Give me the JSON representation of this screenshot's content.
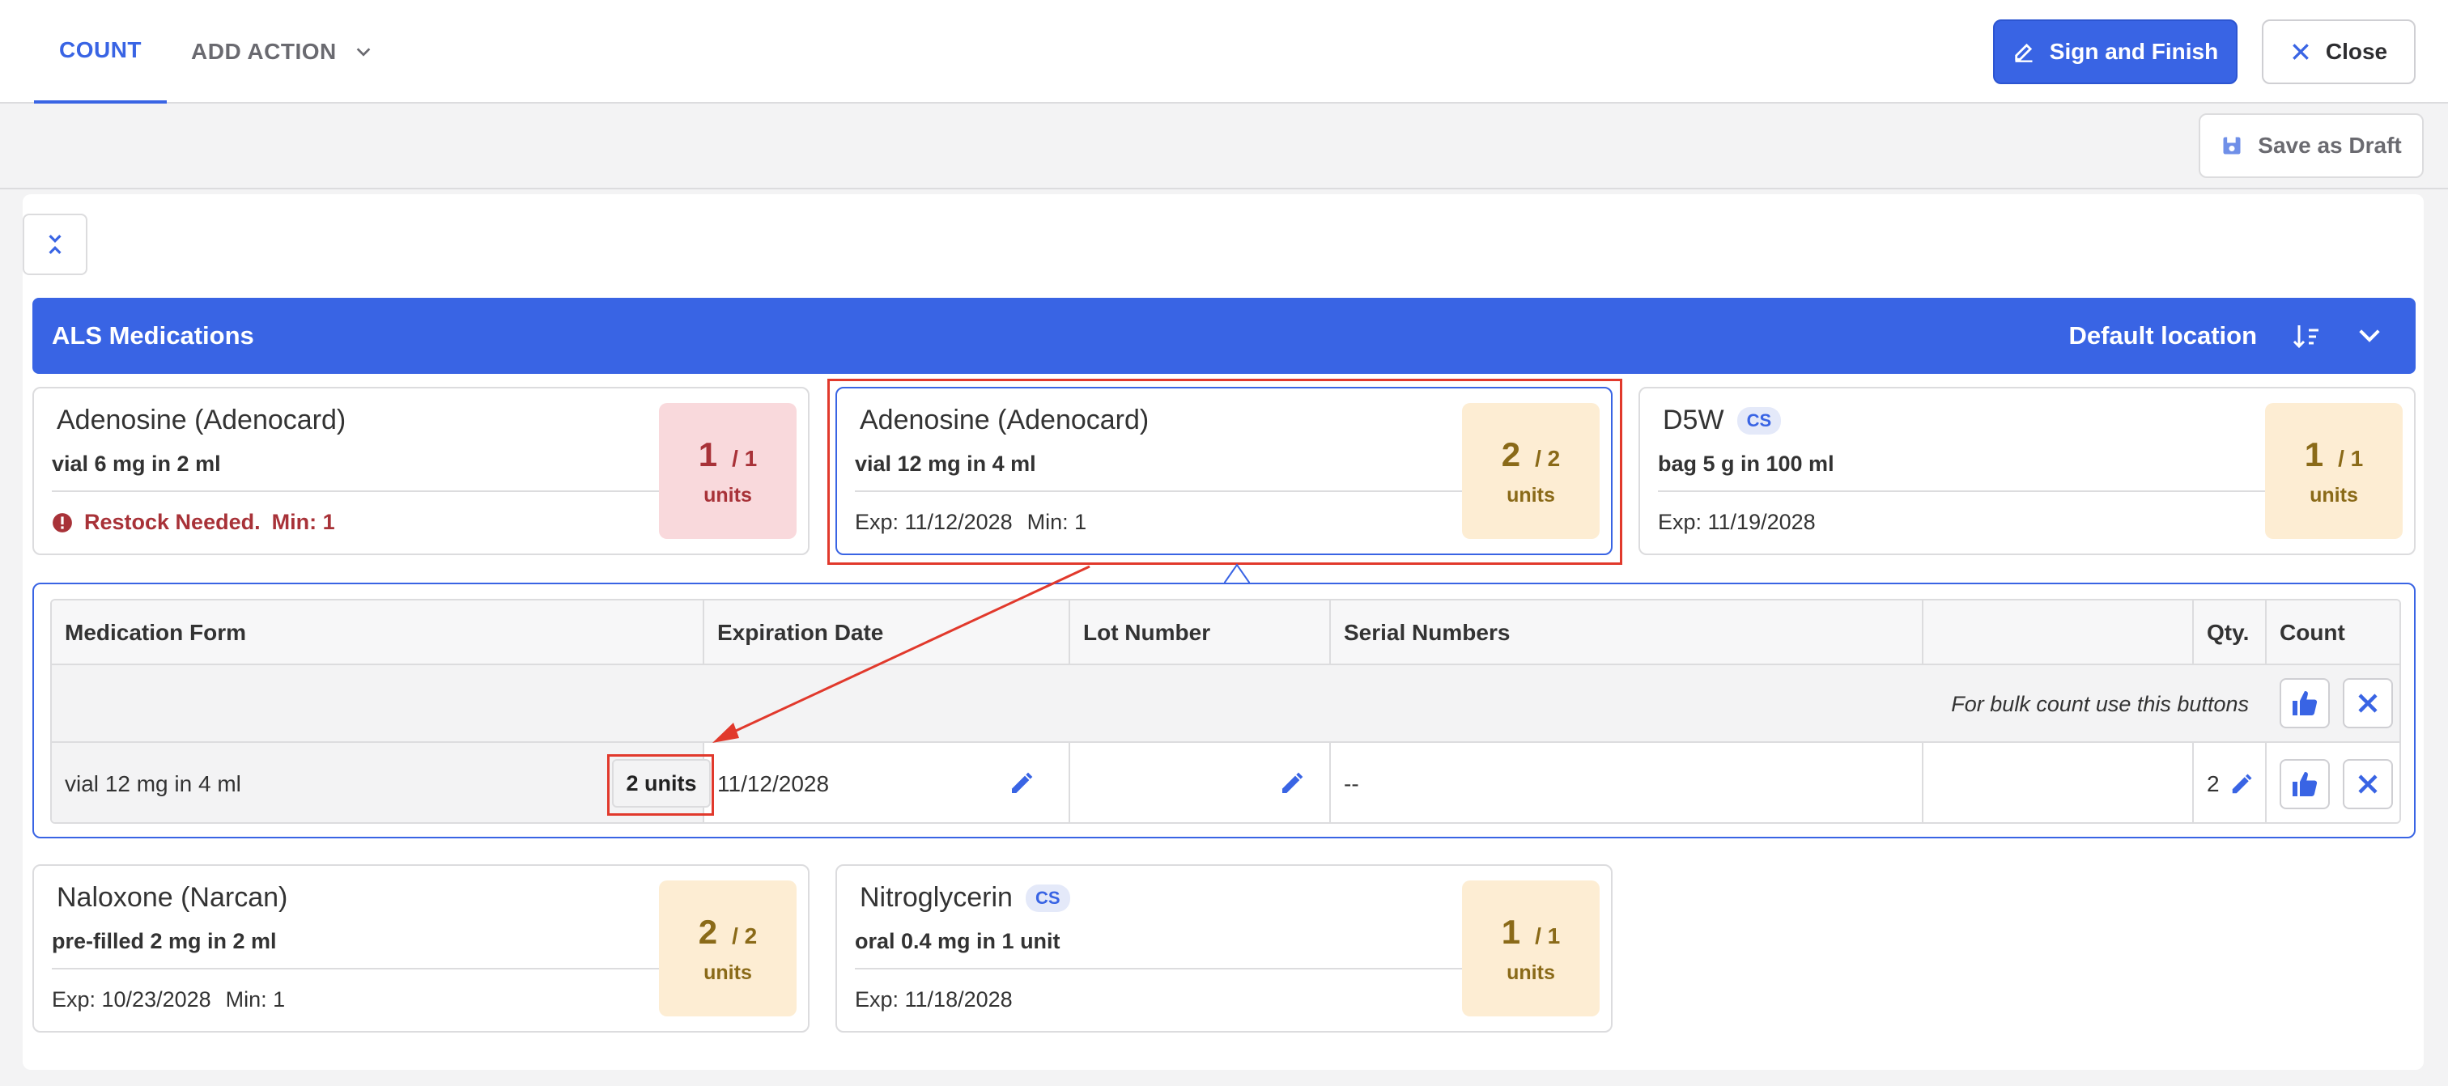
{
  "tabs": {
    "count": "COUNT",
    "add_action": "ADD ACTION"
  },
  "actions": {
    "sign_finish": "Sign and Finish",
    "close": "Close",
    "save_draft": "Save as Draft"
  },
  "section": {
    "title": "ALS Medications",
    "location": "Default location"
  },
  "cards": [
    {
      "name": "Adenosine (Adenocard)",
      "form": "vial 6 mg in 2 ml",
      "alert": "Restock Needed.",
      "min": "Min: 1",
      "count": "1",
      "total": "/ 1",
      "unit": "units",
      "status": "red"
    },
    {
      "name": "Adenosine (Adenocard)",
      "form": "vial 12 mg in 4 ml",
      "exp": "Exp: 11/12/2028",
      "min": "Min: 1",
      "count": "2",
      "total": "/ 2",
      "unit": "units",
      "status": "amber",
      "selected": true
    },
    {
      "name": "D5W",
      "badge": "CS",
      "form": "bag 5 g in 100 ml",
      "exp": "Exp: 11/19/2028",
      "count": "1",
      "total": "/ 1",
      "unit": "units",
      "status": "amber"
    },
    {
      "name": "Naloxone (Narcan)",
      "form": "pre-filled 2 mg in 2 ml",
      "exp": "Exp: 10/23/2028",
      "min": "Min: 1",
      "count": "2",
      "total": "/ 2",
      "unit": "units",
      "status": "amber"
    },
    {
      "name": "Nitroglycerin",
      "badge": "CS",
      "form": "oral 0.4 mg in 1 unit",
      "exp": "Exp: 11/18/2028",
      "count": "1",
      "total": "/ 1",
      "unit": "units",
      "status": "amber"
    }
  ],
  "table": {
    "headers": [
      "Medication Form",
      "Expiration Date",
      "Lot Number",
      "Serial Numbers",
      "",
      "Qty.",
      "Count"
    ],
    "bulk_text": "For bulk count use this buttons",
    "row": {
      "form": "vial 12 mg in 4 ml",
      "units": "2 units",
      "expiration": "11/12/2028",
      "lot": "",
      "serial": "--",
      "qty": "2"
    }
  },
  "colors": {
    "accent": "#3964e4",
    "alert": "#a83238",
    "annotation": "#e1392c"
  },
  "icons": [
    "chevron-down-icon",
    "pencil-icon",
    "close-icon",
    "save-icon",
    "collapse-icon",
    "sort-icon",
    "alert-icon",
    "thumbs-up-icon",
    "x-icon"
  ]
}
